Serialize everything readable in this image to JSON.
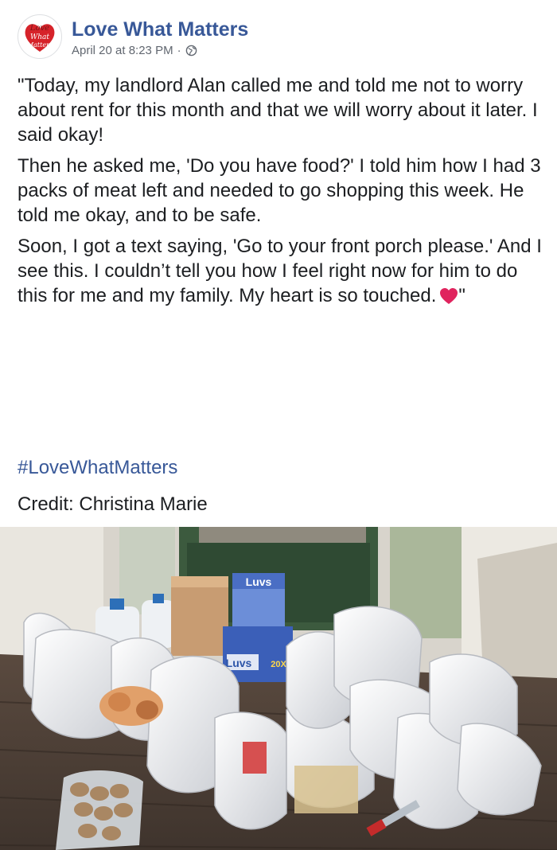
{
  "post": {
    "page_name": "Love What Matters",
    "logo_text": "Love What Matters",
    "date": "April 20 at 8:23 PM",
    "separator": "·",
    "audience_icon": "globe-icon",
    "paragraphs": [
      "\"Today, my landlord Alan called me and told me not to worry about rent for this month and that we will worry about it later. I said okay!",
      "Then he asked me, 'Do you have food?' I told him how I had 3 packs of meat left and needed to go shopping this week. He told me okay, and to be safe.",
      "Soon, I got a text saying, 'Go to your front porch please.' And I see this. I couldn’t tell you how I feel right now for him to do this for me and my family. My heart is so touched."
    ],
    "closing_quote": "\"",
    "emoji_icon": "red-heart-icon",
    "hashtag": "#LoveWhatMatters",
    "credit": "Credit: Christina Marie"
  },
  "photo": {
    "package_text_top": "Luvs",
    "package_text_bottom": "Luvs",
    "package_count": "20X"
  },
  "colors": {
    "link": "#385898",
    "text": "#1c1e21",
    "meta": "#616770",
    "heart": "#e0245e"
  }
}
